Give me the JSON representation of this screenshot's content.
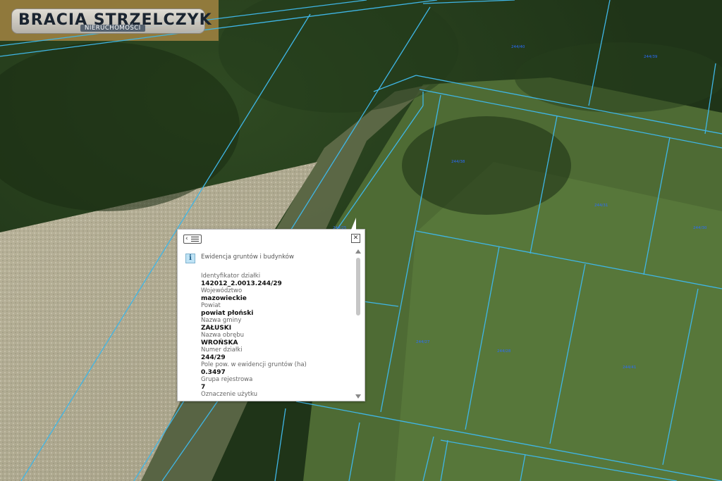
{
  "logo": {
    "title": "BRACIA STRZELCZYK",
    "subtitle": "NIERUCHOMOŚCI"
  },
  "map": {
    "parcel_labels": [
      "244/40",
      "244/39",
      "244/38",
      "244/31",
      "244/30",
      "244/27",
      "244/28",
      "244/41",
      "244/25"
    ],
    "boundary_color": "#3fb6e6"
  },
  "popup": {
    "icons": {
      "back": "list-back-icon",
      "close": "close-icon",
      "info": "info-icon"
    },
    "title": "Ewidencja gruntów i budynków",
    "fields": [
      {
        "label": "Identyfikator działki",
        "value": "142012_2.0013.244/29"
      },
      {
        "label": "Województwo",
        "value": "mazowieckie"
      },
      {
        "label": "Powiat",
        "value": "powiat płoński"
      },
      {
        "label": "Nazwa gminy",
        "value": "ZAŁUSKI"
      },
      {
        "label": "Nazwa obrębu",
        "value": "WROŃSKA"
      },
      {
        "label": "Numer działki",
        "value": "244/29"
      },
      {
        "label": "Pole pow. w ewidencji gruntów (ha)",
        "value": "0.3497"
      },
      {
        "label": "Grupa rejestrowa",
        "value": "7"
      },
      {
        "label": "Oznaczenie użytku",
        "value": ""
      }
    ]
  }
}
